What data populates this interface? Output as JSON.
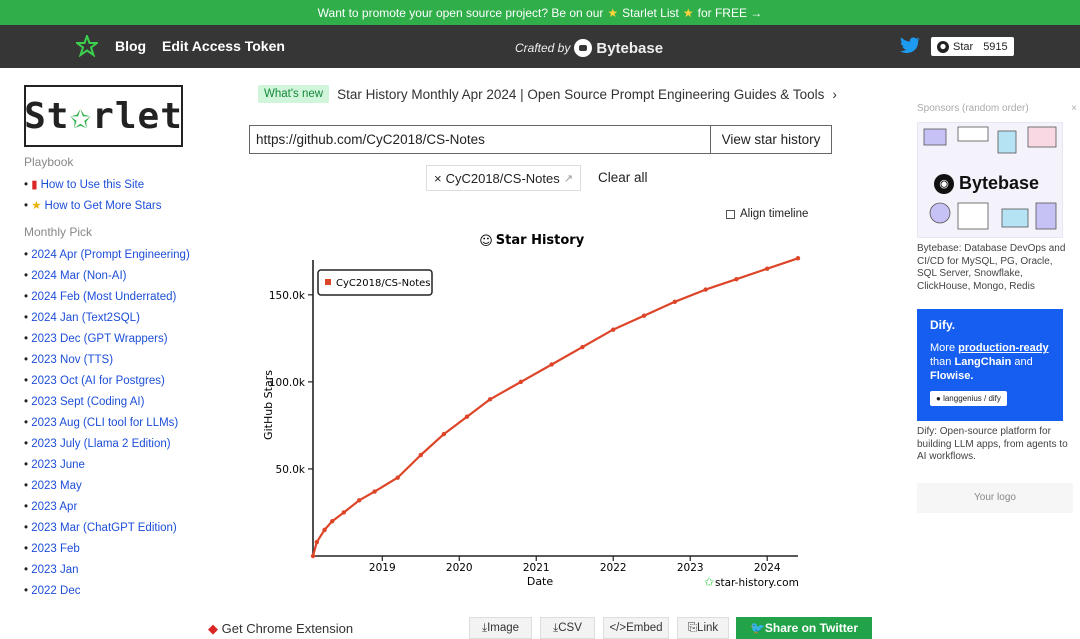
{
  "banner": {
    "pre": "Want to promote your open source project? Be on our",
    "link": "Starlet List",
    "post": "for FREE →"
  },
  "nav": {
    "blog": "Blog",
    "edit_token": "Edit Access Token",
    "crafted_by": "Crafted by",
    "brand": "Bytebase",
    "star_label": "Star",
    "star_count": "5915"
  },
  "sidebar": {
    "logo_text_pre": "St",
    "logo_text_post": "rlet",
    "playbook_title": "Playbook",
    "playbook": [
      {
        "label": "How to Use this Site",
        "icon": "book-icon"
      },
      {
        "label": "How to Get More Stars",
        "icon": "star-icon"
      }
    ],
    "monthly_title": "Monthly Pick",
    "monthly": [
      "2024 Apr (Prompt Engineering)",
      "2024 Mar (Non-AI)",
      "2024 Feb (Most Underrated)",
      "2024 Jan (Text2SQL)",
      "2023 Dec (GPT Wrappers)",
      "2023 Nov (TTS)",
      "2023 Oct (AI for Postgres)",
      "2023 Sept (Coding AI)",
      "2023 Aug (CLI tool for LLMs)",
      "2023 July (Llama 2 Edition)",
      "2023 June",
      "2023 May",
      "2023 Apr",
      "2023 Mar (ChatGPT Edition)",
      "2023 Feb",
      "2023 Jan",
      "2022 Dec"
    ]
  },
  "main": {
    "whatsnew_badge": "What's new",
    "whatsnew_text": "Star History Monthly Apr 2024 | Open Source Prompt Engineering Guides & Tools",
    "url_value": "https://github.com/CyC2018/CS-Notes",
    "view_button": "View star history",
    "repo_chip": "CyC2018/CS-Notes",
    "clear_all": "Clear all",
    "align_timeline": "Align timeline"
  },
  "chart_data": {
    "type": "line",
    "title": "Star History",
    "xlabel": "Date",
    "ylabel": "GitHub Stars",
    "x_ticks": [
      "2019",
      "2020",
      "2021",
      "2022",
      "2023",
      "2024"
    ],
    "y_ticks": [
      "50.0k",
      "100.0k",
      "150.0k"
    ],
    "ylim": [
      0,
      170000
    ],
    "legend": "top-left",
    "watermark": "star-history.com",
    "series": [
      {
        "name": "CyC2018/CS-Notes",
        "color": "#dd4528",
        "points": [
          [
            2018.1,
            0
          ],
          [
            2018.15,
            8000
          ],
          [
            2018.25,
            15000
          ],
          [
            2018.35,
            20000
          ],
          [
            2018.5,
            25000
          ],
          [
            2018.7,
            32000
          ],
          [
            2018.9,
            37000
          ],
          [
            2019.2,
            45000
          ],
          [
            2019.5,
            58000
          ],
          [
            2019.8,
            70000
          ],
          [
            2020.1,
            80000
          ],
          [
            2020.4,
            90000
          ],
          [
            2020.8,
            100000
          ],
          [
            2021.2,
            110000
          ],
          [
            2021.6,
            120000
          ],
          [
            2022.0,
            130000
          ],
          [
            2022.4,
            138000
          ],
          [
            2022.8,
            146000
          ],
          [
            2023.2,
            153000
          ],
          [
            2023.6,
            159000
          ],
          [
            2024.0,
            165000
          ],
          [
            2024.4,
            171000
          ]
        ]
      }
    ]
  },
  "bottom": {
    "chrome_ext": "Get Chrome Extension",
    "image": "Image",
    "csv": "CSV",
    "embed": "Embed",
    "link": "Link",
    "share": "Share on Twitter"
  },
  "sponsors": {
    "title": "Sponsors (random order)",
    "close": "×",
    "bytebase_brand": "Bytebase",
    "bytebase_desc": "Bytebase: Database DevOps and CI/CD for MySQL, PG, Oracle, SQL Server, Snowflake, ClickHouse, Mongo, Redis",
    "dify_brand": "Dify.",
    "dify_pre": "More",
    "dify_em": "production-ready",
    "dify_mid": "than",
    "dify_b1": "LangChain",
    "dify_and": "and",
    "dify_b2": "Flowise.",
    "dify_gh": "langgenius / dify",
    "dify_desc": "Dify: Open-source platform for building LLM apps, from agents to AI workflows.",
    "your_logo": "Your logo"
  }
}
